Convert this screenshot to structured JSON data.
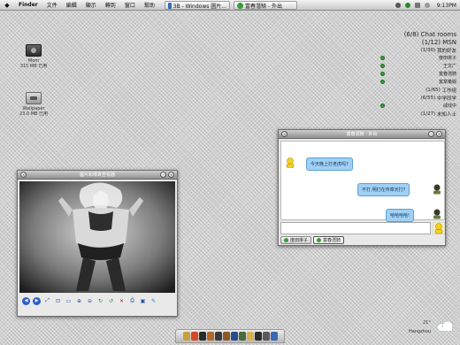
{
  "menubar": {
    "apple_glyph": "◆",
    "app_name": "Finder",
    "items": [
      "文件",
      "編輯",
      "顯示",
      "轉到",
      "窗口",
      "幫助"
    ],
    "tasks": [
      {
        "label": "3B - Windows 圖片..."
      },
      {
        "label": "富春潛騎 - 外出"
      }
    ],
    "clock": "9:13PM"
  },
  "desktop_icons": [
    {
      "label": "Mom",
      "size": "315 MB 已用"
    },
    {
      "label": "Wallpaper",
      "size": "23.0 MB 已用"
    }
  ],
  "buddy_list": {
    "groups": [
      {
        "count": "(6/8)",
        "name": "Chat rooms"
      },
      {
        "count": "(1/12)",
        "name": "MSN"
      },
      {
        "count": "(1/30)",
        "name": "我的好友"
      },
      {
        "name": "度田徘子"
      },
      {
        "name": "王文广"
      },
      {
        "name": "富春潛騎"
      },
      {
        "name": "富章策娟"
      },
      {
        "count": "(1/65)",
        "name": "工作组"
      },
      {
        "count": "(6/55)",
        "name": "中学同学"
      },
      {
        "name": "咸线中"
      },
      {
        "count": "(1/27)",
        "name": "未知人士"
      }
    ]
  },
  "photo_viewer": {
    "title": "圖片和傳真查看器",
    "toolbar_icons": [
      "prev-icon",
      "next-icon",
      "fit-icon",
      "actual-size-icon",
      "slideshow-icon",
      "zoom-in-icon",
      "zoom-out-icon",
      "rotate-cw-icon",
      "rotate-ccw-icon",
      "delete-icon",
      "print-icon",
      "save-icon",
      "edit-icon"
    ]
  },
  "chat_window": {
    "title": "富春潛騎 - 外出",
    "messages": [
      {
        "from": "them",
        "text": "今天晚上打老虎吗?"
      },
      {
        "from": "me",
        "text": "不打,明打在传章天打?"
      },
      {
        "from": "me",
        "text": "哈哈哈哈!"
      }
    ],
    "tabs": [
      {
        "label": "度田徘子",
        "active": false
      },
      {
        "label": "富春潛騎",
        "active": true
      }
    ]
  },
  "weather": {
    "temp": "21°",
    "city": "Hangzhou"
  },
  "colors": {
    "bubble": "#9fd0f5",
    "online": "#3a9a3a",
    "dock_icons": [
      "#c8a040",
      "#d14a2a",
      "#2a2a2a",
      "#b06a2a",
      "#3a3a3a",
      "#8a5a2a",
      "#2a4a8a",
      "#4a6a3a",
      "#d8b050",
      "#2a2a2a",
      "#5a5a5a",
      "#3a6ab0"
    ]
  }
}
